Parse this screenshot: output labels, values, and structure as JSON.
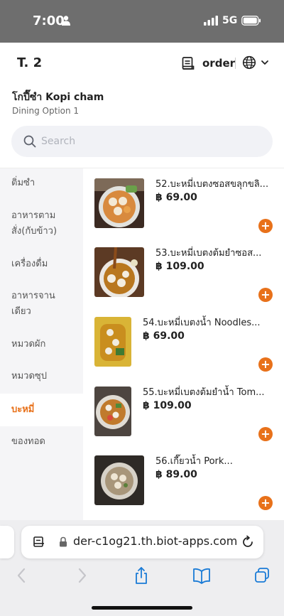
{
  "status_bar": {
    "time": "7:00",
    "network": "5G"
  },
  "header": {
    "store_code": "T. 2",
    "order_label": "order",
    "store_name": "โกปี๊ซำ Kopi cham",
    "dining_option": "Dining Option 1"
  },
  "search": {
    "placeholder": "Search"
  },
  "sidebar": {
    "categories": [
      {
        "label": "ติ่มซำ",
        "active": false
      },
      {
        "label": "อาหารตาม\nสั่ง(กับข้าว)",
        "active": false
      },
      {
        "label": "เครื่องดื่ม",
        "active": false
      },
      {
        "label": "อาหารจาน\nเดียว",
        "active": false
      },
      {
        "label": "หมวดผัก",
        "active": false
      },
      {
        "label": "หมวดซุป",
        "active": false
      },
      {
        "label": "บะหมี่",
        "active": true
      },
      {
        "label": "ของทอด",
        "active": false
      }
    ]
  },
  "menu_items": [
    {
      "name": "52.บะหมี่เบตงซอสขลุกขลิ...",
      "price": "฿ 69.00"
    },
    {
      "name": "53.บะหมี่เบตงต้มยำซอส...",
      "price": "฿ 109.00"
    },
    {
      "name": "54.บะหมี่เบตงน้ำ Noodles...",
      "price": "฿ 69.00"
    },
    {
      "name": "55.บะหมี่เบตงต้มยำน้ำ Tom...",
      "price": "฿ 109.00"
    },
    {
      "name": "56.เกี๊ยวน้ำ Pork...",
      "price": "฿ 89.00"
    }
  ],
  "browser": {
    "url": "der-c1og21.th.biot-apps.com"
  },
  "colors": {
    "accent": "#e8711a",
    "status_bar": "#6e6e6e",
    "ios_blue": "#1a7bd6"
  },
  "icons": [
    "person-icon",
    "signal-icon",
    "battery-icon",
    "receipt-icon",
    "globe-icon",
    "chevron-down-icon",
    "search-icon",
    "plus-icon",
    "reader-icon",
    "lock-icon",
    "reload-icon",
    "back-icon",
    "forward-icon",
    "share-icon",
    "bookmarks-icon",
    "tabs-icon"
  ]
}
